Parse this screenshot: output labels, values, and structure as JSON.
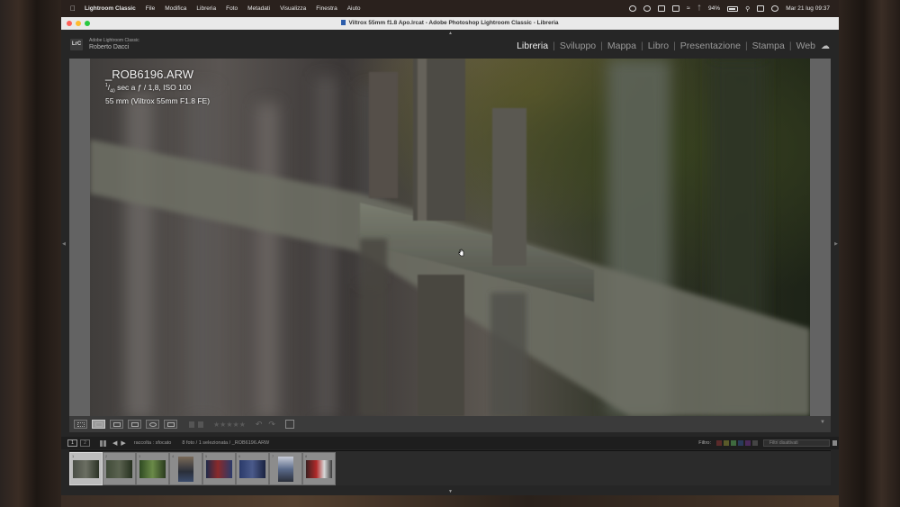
{
  "menubar": {
    "items": [
      "Lightroom Classic",
      "File",
      "Modifica",
      "Libreria",
      "Foto",
      "Metadati",
      "Visualizza",
      "Finestra",
      "Aiuto"
    ],
    "battery": "94%",
    "clock": "Mar 21 lug  09:37"
  },
  "window": {
    "title": "Viltrox 55mm f1.8 Apo.lrcat - Adobe Photoshop Lightroom Classic - Libreria"
  },
  "identity": {
    "badge": "LrC",
    "product": "Adobe Lightroom Classic",
    "user": "Roberto Dacci"
  },
  "modules": [
    "Libreria",
    "Sviluppo",
    "Mappa",
    "Libro",
    "Presentazione",
    "Stampa",
    "Web"
  ],
  "active_module": "Libreria",
  "photo_info": {
    "filename": "_ROB6196.ARW",
    "exposure_num": "1",
    "exposure_den": "40",
    "exposure_rest": " sec a ƒ / 1,8, ISO 100",
    "lens": "55 mm (Viltrox 55mm F1.8 FE)"
  },
  "toolbar": {
    "stars": "★★★★★"
  },
  "filmstrip_header": {
    "screen1": "1",
    "screen2": "2",
    "collection": "raccolta : sfocato",
    "count": "8 foto / 1 selezionata / _ROB6196.ARW",
    "filter_label": "Filtro:",
    "filter_value": "Filtri disattivati"
  },
  "filmstrip": {
    "selected_index": 0,
    "cells": [
      {
        "num": "1"
      },
      {
        "num": "2"
      },
      {
        "num": "3"
      },
      {
        "num": "4"
      },
      {
        "num": "5"
      },
      {
        "num": "6"
      },
      {
        "num": "7"
      },
      {
        "num": "8"
      }
    ]
  },
  "colors": {
    "accent_active_module": "#f0f0f0",
    "panel_bg": "#262626",
    "loupe_bg": "#5f5f5f"
  }
}
